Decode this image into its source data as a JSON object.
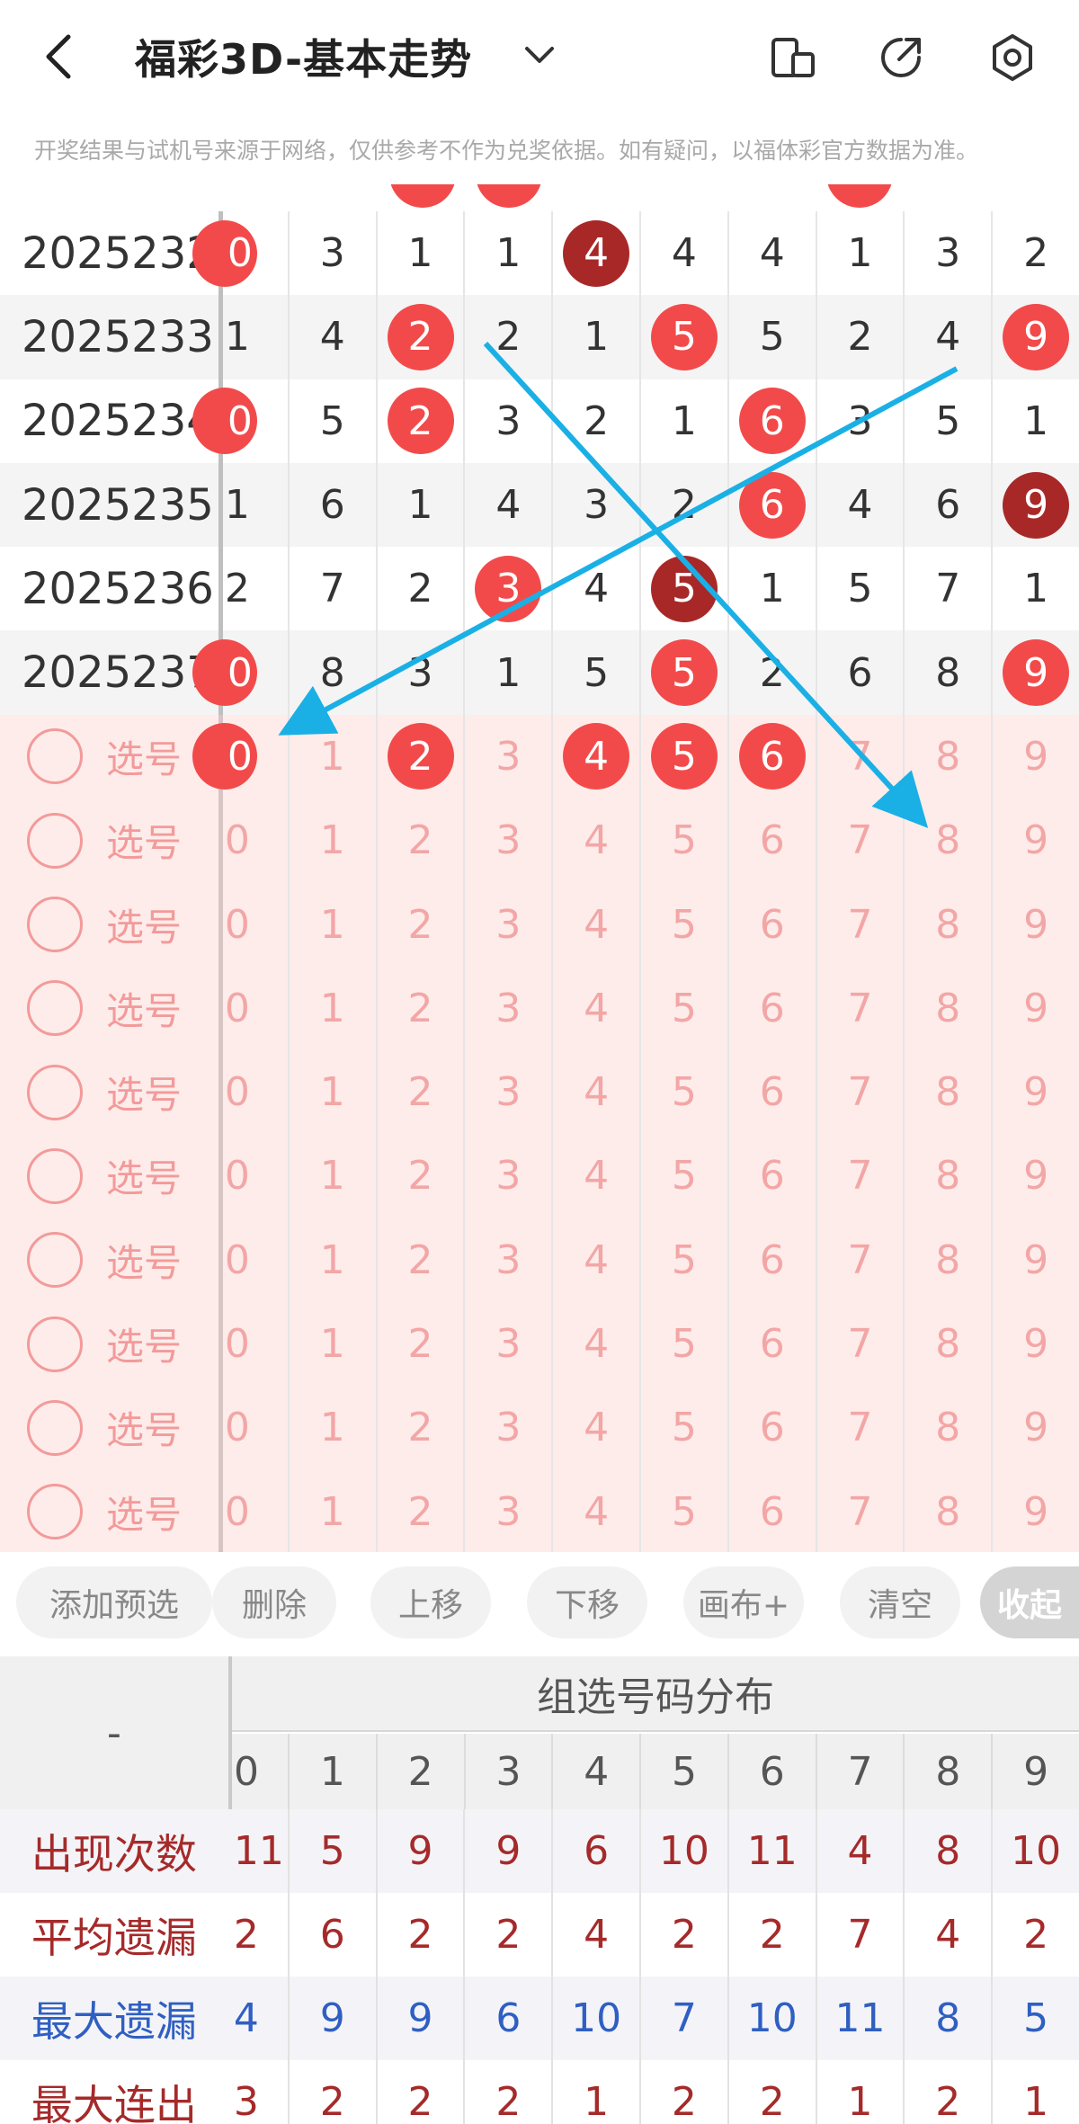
{
  "header": {
    "title": "福彩3D-基本走势",
    "notice": "开奖结果与试机号来源于网络，仅供参考不作为兑奖依据。如有疑问，以福体彩官方数据为准。"
  },
  "draws": [
    {
      "period": "2025232",
      "cells": [
        "0",
        "3",
        "1",
        "1",
        "4",
        "4",
        "4",
        "1",
        "3",
        "2"
      ],
      "balls": [
        0,
        4
      ],
      "dark": [
        4
      ]
    },
    {
      "period": "2025233",
      "cells": [
        "1",
        "4",
        "2",
        "2",
        "1",
        "5",
        "5",
        "2",
        "4",
        "9"
      ],
      "balls": [
        2,
        5,
        9
      ],
      "dark": []
    },
    {
      "period": "2025234",
      "cells": [
        "0",
        "5",
        "2",
        "3",
        "2",
        "1",
        "6",
        "3",
        "5",
        "1"
      ],
      "balls": [
        0,
        2,
        6
      ],
      "dark": []
    },
    {
      "period": "2025235",
      "cells": [
        "1",
        "6",
        "1",
        "4",
        "3",
        "2",
        "6",
        "4",
        "6",
        "9"
      ],
      "balls": [
        6,
        9
      ],
      "dark": [
        9
      ]
    },
    {
      "period": "2025236",
      "cells": [
        "2",
        "7",
        "2",
        "3",
        "4",
        "5",
        "1",
        "5",
        "7",
        "1"
      ],
      "balls": [
        3,
        5
      ],
      "dark": [
        5
      ]
    },
    {
      "period": "2025237",
      "cells": [
        "0",
        "8",
        "3",
        "1",
        "5",
        "5",
        "2",
        "6",
        "8",
        "9"
      ],
      "balls": [
        0,
        5,
        9
      ],
      "dark": []
    }
  ],
  "pick": {
    "label": "选号",
    "digits": [
      "0",
      "1",
      "2",
      "3",
      "4",
      "5",
      "6",
      "7",
      "8",
      "9"
    ],
    "rows": 10,
    "selected_first_row": [
      0,
      2,
      4,
      5,
      6
    ]
  },
  "toolbar": {
    "add": "添加预选",
    "delete": "删除",
    "up": "上移",
    "down": "下移",
    "canvas": "画布+",
    "clear": "清空",
    "collapse": "收起"
  },
  "dist": {
    "corner": "-",
    "title": "组选号码分布",
    "digits": [
      "0",
      "1",
      "2",
      "3",
      "4",
      "5",
      "6",
      "7",
      "8",
      "9"
    ],
    "rows": [
      {
        "label": "出现次数",
        "color": "#a52a2a",
        "values": [
          "11",
          "5",
          "9",
          "9",
          "6",
          "10",
          "11",
          "4",
          "8",
          "10"
        ]
      },
      {
        "label": "平均遗漏",
        "color": "#a52a2a",
        "values": [
          "2",
          "6",
          "2",
          "2",
          "4",
          "2",
          "2",
          "7",
          "4",
          "2"
        ]
      },
      {
        "label": "最大遗漏",
        "color": "#2f5fc2",
        "values": [
          "4",
          "9",
          "9",
          "6",
          "10",
          "7",
          "10",
          "11",
          "8",
          "5"
        ]
      },
      {
        "label": "最大连出",
        "color": "#a52a2a",
        "values": [
          "3",
          "2",
          "2",
          "2",
          "1",
          "2",
          "2",
          "1",
          "2",
          "1"
        ]
      }
    ]
  },
  "colors": {
    "ball": "#f24a4a",
    "ball_dark": "#a82828",
    "arrow": "#1ab0e6"
  }
}
